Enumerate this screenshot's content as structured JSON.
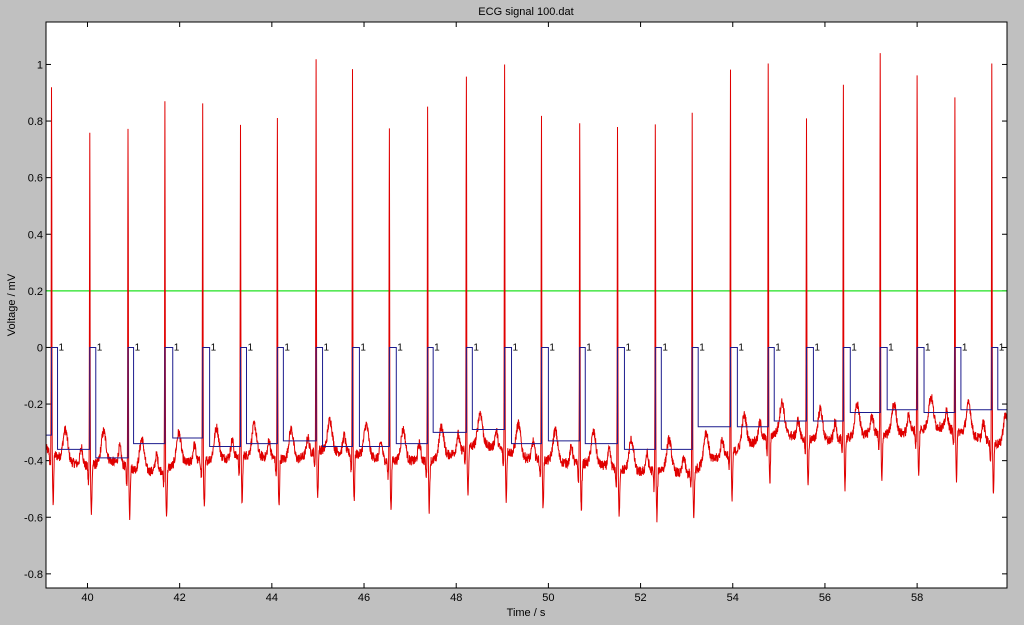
{
  "window": {
    "background": "#c0c0c0"
  },
  "chart_data": {
    "type": "line",
    "title": "ECG signal 100.dat",
    "xlabel": "Time / s",
    "ylabel": "Voltage / mV",
    "xlim": [
      39.1,
      59.95
    ],
    "ylim": [
      -0.85,
      1.15
    ],
    "xticks": [
      40,
      42,
      44,
      46,
      48,
      50,
      52,
      54,
      56,
      58
    ],
    "yticks": [
      -0.8,
      -0.6,
      -0.4,
      -0.2,
      0,
      0.2,
      0.4,
      0.6,
      0.8,
      1
    ],
    "ytick_labels": [
      "-0.8",
      "-0.6",
      "-0.4",
      "-0.2",
      "0",
      "0.2",
      "0.4",
      "0.6",
      "0.8",
      "1"
    ],
    "grid": false,
    "legend": "none",
    "series": [
      {
        "kind": "ecg",
        "color": "#e00000",
        "baseline_points": [
          [
            39.1,
            -0.36
          ],
          [
            39.5,
            -0.4
          ],
          [
            40.0,
            -0.42
          ],
          [
            40.5,
            -0.4
          ],
          [
            41.0,
            -0.43
          ],
          [
            41.5,
            -0.44
          ],
          [
            42.0,
            -0.41
          ],
          [
            42.5,
            -0.4
          ],
          [
            43.0,
            -0.39
          ],
          [
            43.5,
            -0.38
          ],
          [
            44.0,
            -0.39
          ],
          [
            44.5,
            -0.4
          ],
          [
            45.0,
            -0.36
          ],
          [
            45.5,
            -0.37
          ],
          [
            46.0,
            -0.38
          ],
          [
            46.5,
            -0.4
          ],
          [
            47.0,
            -0.4
          ],
          [
            47.5,
            -0.4
          ],
          [
            48.0,
            -0.37
          ],
          [
            48.5,
            -0.34
          ],
          [
            49.0,
            -0.36
          ],
          [
            49.5,
            -0.39
          ],
          [
            50.0,
            -0.4
          ],
          [
            50.5,
            -0.41
          ],
          [
            51.0,
            -0.41
          ],
          [
            51.5,
            -0.43
          ],
          [
            52.0,
            -0.44
          ],
          [
            52.5,
            -0.43
          ],
          [
            53.0,
            -0.45
          ],
          [
            53.5,
            -0.4
          ],
          [
            54.0,
            -0.37
          ],
          [
            54.5,
            -0.33
          ],
          [
            55.0,
            -0.3
          ],
          [
            55.5,
            -0.32
          ],
          [
            56.0,
            -0.33
          ],
          [
            56.5,
            -0.32
          ],
          [
            57.0,
            -0.3
          ],
          [
            57.5,
            -0.31
          ],
          [
            58.0,
            -0.29
          ],
          [
            58.5,
            -0.28
          ],
          [
            59.0,
            -0.3
          ],
          [
            59.5,
            -0.33
          ],
          [
            59.95,
            -0.35
          ]
        ],
        "r_peaks": [
          [
            39.22,
            0.93
          ],
          [
            40.05,
            0.77
          ],
          [
            40.88,
            0.77
          ],
          [
            41.68,
            0.88
          ],
          [
            42.5,
            0.85
          ],
          [
            43.32,
            0.8
          ],
          [
            44.12,
            0.82
          ],
          [
            44.96,
            1.02
          ],
          [
            45.75,
            0.99
          ],
          [
            46.55,
            0.76
          ],
          [
            47.38,
            0.86
          ],
          [
            48.22,
            0.96
          ],
          [
            49.05,
            1.02
          ],
          [
            49.85,
            0.81
          ],
          [
            50.68,
            0.81
          ],
          [
            51.5,
            0.78
          ],
          [
            52.32,
            0.78
          ],
          [
            53.12,
            0.83
          ],
          [
            53.95,
            0.98
          ],
          [
            54.77,
            0.99
          ],
          [
            55.6,
            0.83
          ],
          [
            56.4,
            0.92
          ],
          [
            57.2,
            1.03
          ],
          [
            58.0,
            0.98
          ],
          [
            58.82,
            0.9
          ],
          [
            59.62,
            1.0
          ]
        ]
      },
      {
        "kind": "threshold",
        "color": "#22e022",
        "y": 0.2
      },
      {
        "kind": "pulse",
        "color": "#1c1c8e",
        "label": "1",
        "pulses": [
          [
            39.22,
            39.35,
            -0.31
          ],
          [
            40.05,
            40.18,
            -0.36
          ],
          [
            40.88,
            41.0,
            -0.39
          ],
          [
            41.68,
            41.85,
            -0.34
          ],
          [
            42.5,
            42.65,
            -0.32
          ],
          [
            43.32,
            43.45,
            -0.35
          ],
          [
            44.12,
            44.25,
            -0.34
          ],
          [
            44.96,
            45.1,
            -0.33
          ],
          [
            45.75,
            45.9,
            -0.35
          ],
          [
            46.55,
            46.7,
            -0.35
          ],
          [
            47.38,
            47.5,
            -0.34
          ],
          [
            48.22,
            48.35,
            -0.3
          ],
          [
            49.05,
            49.2,
            -0.29
          ],
          [
            49.85,
            50.0,
            -0.34
          ],
          [
            50.68,
            50.8,
            -0.33
          ],
          [
            51.5,
            51.65,
            -0.34
          ],
          [
            52.32,
            52.45,
            -0.36
          ],
          [
            53.12,
            53.25,
            -0.36
          ],
          [
            53.95,
            54.1,
            -0.28
          ],
          [
            54.77,
            54.9,
            -0.28
          ],
          [
            55.6,
            55.75,
            -0.26
          ],
          [
            56.4,
            56.55,
            -0.26
          ],
          [
            57.2,
            57.35,
            -0.23
          ],
          [
            58.0,
            58.15,
            -0.22
          ],
          [
            58.82,
            58.95,
            -0.23
          ],
          [
            59.62,
            59.75,
            -0.22
          ]
        ]
      }
    ]
  }
}
